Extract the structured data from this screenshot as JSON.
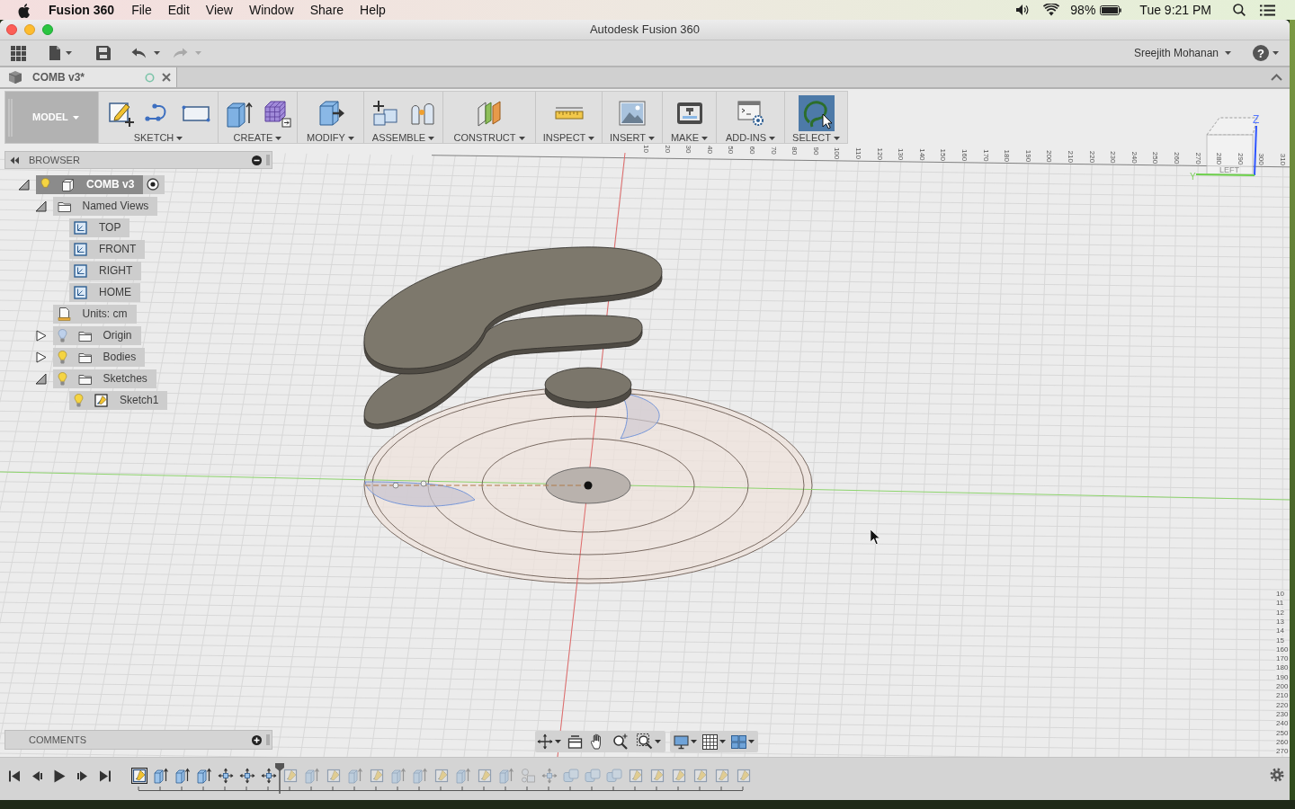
{
  "menu_bar": {
    "app": "Fusion 360",
    "menus": [
      "File",
      "Edit",
      "View",
      "Window",
      "Share",
      "Help"
    ],
    "battery": "98%",
    "clock": "Tue 9:21 PM"
  },
  "window": {
    "title": "Autodesk Fusion 360"
  },
  "quick_access": {
    "undo": {
      "disabled": false
    },
    "redo": {
      "disabled": true
    },
    "user": "Sreejith Mohanan",
    "help": "?"
  },
  "document_tabs": [
    {
      "title": "COMB v3*",
      "selected": true
    }
  ],
  "toolbar": {
    "workspace": "MODEL",
    "groups": [
      {
        "kind": "sketch",
        "label": "SKETCH",
        "selected": false
      },
      {
        "kind": "create",
        "label": "CREATE",
        "selected": false
      },
      {
        "kind": "modify",
        "label": "MODIFY",
        "selected": false
      },
      {
        "kind": "assemble",
        "label": "ASSEMBLE",
        "selected": false
      },
      {
        "kind": "construct",
        "label": "CONSTRUCT",
        "selected": false
      },
      {
        "kind": "inspect",
        "label": "INSPECT",
        "selected": false
      },
      {
        "kind": "insert",
        "label": "INSERT",
        "selected": false
      },
      {
        "kind": "make",
        "label": "MAKE",
        "selected": false
      },
      {
        "kind": "addins",
        "label": "ADD-INS",
        "selected": false
      },
      {
        "kind": "select",
        "label": "SELECT",
        "selected": true
      }
    ]
  },
  "browser": {
    "title": "BROWSER",
    "tree": [
      {
        "label": "COMB v3",
        "kind": "component",
        "expanded": true,
        "visible": true,
        "active": true,
        "children": [
          {
            "label": "Named Views",
            "kind": "folder",
            "expanded": true,
            "children": [
              {
                "label": "TOP",
                "kind": "view"
              },
              {
                "label": "FRONT",
                "kind": "view"
              },
              {
                "label": "RIGHT",
                "kind": "view"
              },
              {
                "label": "HOME",
                "kind": "view"
              }
            ]
          },
          {
            "label": "Units: cm",
            "kind": "units"
          },
          {
            "label": "Origin",
            "kind": "folder",
            "expanded": false,
            "visible": false
          },
          {
            "label": "Bodies",
            "kind": "folder",
            "expanded": false,
            "visible": true
          },
          {
            "label": "Sketches",
            "kind": "folder",
            "expanded": true,
            "visible": true,
            "children": [
              {
                "label": "Sketch1",
                "kind": "sketch",
                "visible": true
              }
            ]
          }
        ]
      }
    ]
  },
  "viewport": {
    "top_ruler": [
      "10",
      "20",
      "30",
      "40",
      "50",
      "60",
      "70",
      "80",
      "90",
      "100",
      "110",
      "120",
      "130",
      "140",
      "150",
      "160",
      "170",
      "180",
      "190",
      "200",
      "210",
      "220",
      "230",
      "240",
      "250",
      "260",
      "270",
      "280",
      "290",
      "300",
      "310"
    ],
    "right_ruler": [
      "10",
      "11",
      "12",
      "13",
      "14",
      "15",
      "160",
      "170",
      "180",
      "190",
      "200",
      "210",
      "220",
      "230",
      "240",
      "250",
      "260",
      "270"
    ],
    "view_cube": {
      "face": "LEFT",
      "up_axis": "Z",
      "side_axis": "Y"
    }
  },
  "comments": {
    "title": "COMMENTS"
  },
  "timeline": {
    "items": [
      {
        "kind": "sketch",
        "selected": true,
        "rolled_back": false
      },
      {
        "kind": "extrude",
        "selected": false,
        "rolled_back": false
      },
      {
        "kind": "extrude",
        "selected": false,
        "rolled_back": false
      },
      {
        "kind": "extrude",
        "selected": false,
        "rolled_back": false
      },
      {
        "kind": "move",
        "selected": false,
        "rolled_back": false
      },
      {
        "kind": "move",
        "selected": false,
        "rolled_back": false
      },
      {
        "kind": "move",
        "selected": false,
        "rolled_back": false
      },
      {
        "kind": "sketch",
        "selected": false,
        "rolled_back": true
      },
      {
        "kind": "extrude",
        "selected": false,
        "rolled_back": true
      },
      {
        "kind": "sketch",
        "selected": false,
        "rolled_back": true
      },
      {
        "kind": "extrude",
        "selected": false,
        "rolled_back": true
      },
      {
        "kind": "sketch",
        "selected": false,
        "rolled_back": true
      },
      {
        "kind": "extrude",
        "selected": false,
        "rolled_back": true
      },
      {
        "kind": "extrude",
        "selected": false,
        "rolled_back": true
      },
      {
        "kind": "sketch",
        "selected": false,
        "rolled_back": true
      },
      {
        "kind": "extrude",
        "selected": false,
        "rolled_back": true
      },
      {
        "kind": "sketch",
        "selected": false,
        "rolled_back": true
      },
      {
        "kind": "extrude",
        "selected": false,
        "rolled_back": true
      },
      {
        "kind": "joint",
        "selected": false,
        "rolled_back": true
      },
      {
        "kind": "move",
        "selected": false,
        "rolled_back": true
      },
      {
        "kind": "combine",
        "selected": false,
        "rolled_back": true
      },
      {
        "kind": "combine",
        "selected": false,
        "rolled_back": true
      },
      {
        "kind": "combine",
        "selected": false,
        "rolled_back": true
      },
      {
        "kind": "sketch",
        "selected": false,
        "rolled_back": true
      },
      {
        "kind": "sketch",
        "selected": false,
        "rolled_back": true
      },
      {
        "kind": "sketch",
        "selected": false,
        "rolled_back": true
      },
      {
        "kind": "sketch",
        "selected": false,
        "rolled_back": true
      },
      {
        "kind": "sketch",
        "selected": false,
        "rolled_back": true
      },
      {
        "kind": "sketch",
        "selected": false,
        "rolled_back": true
      }
    ]
  }
}
